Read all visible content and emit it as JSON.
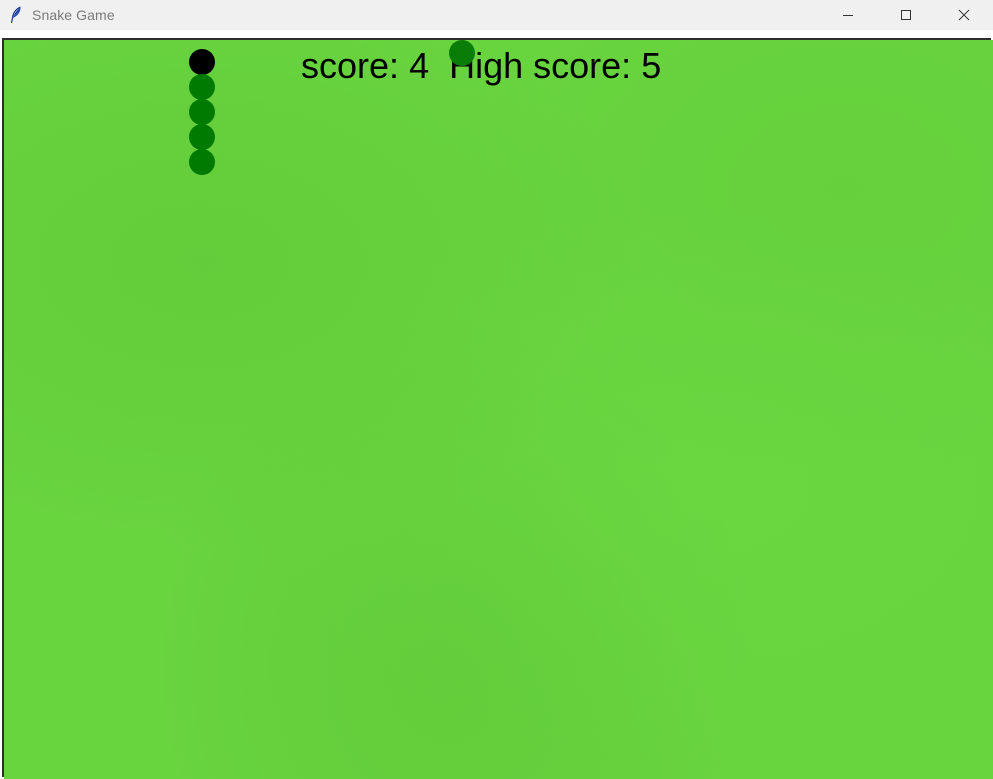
{
  "window": {
    "title": "Snake Game",
    "app_icon": "feather-icon",
    "controls": [
      "minimize-icon",
      "maximize-icon",
      "close-icon"
    ]
  },
  "game": {
    "score_label": "score:",
    "score": 4,
    "high_score_label": "High score:",
    "high_score": 5,
    "background_color": "#68d43e",
    "snake_color": "#007a00",
    "snake_head_color": "#000000",
    "food_color": "#0a7d08"
  }
}
